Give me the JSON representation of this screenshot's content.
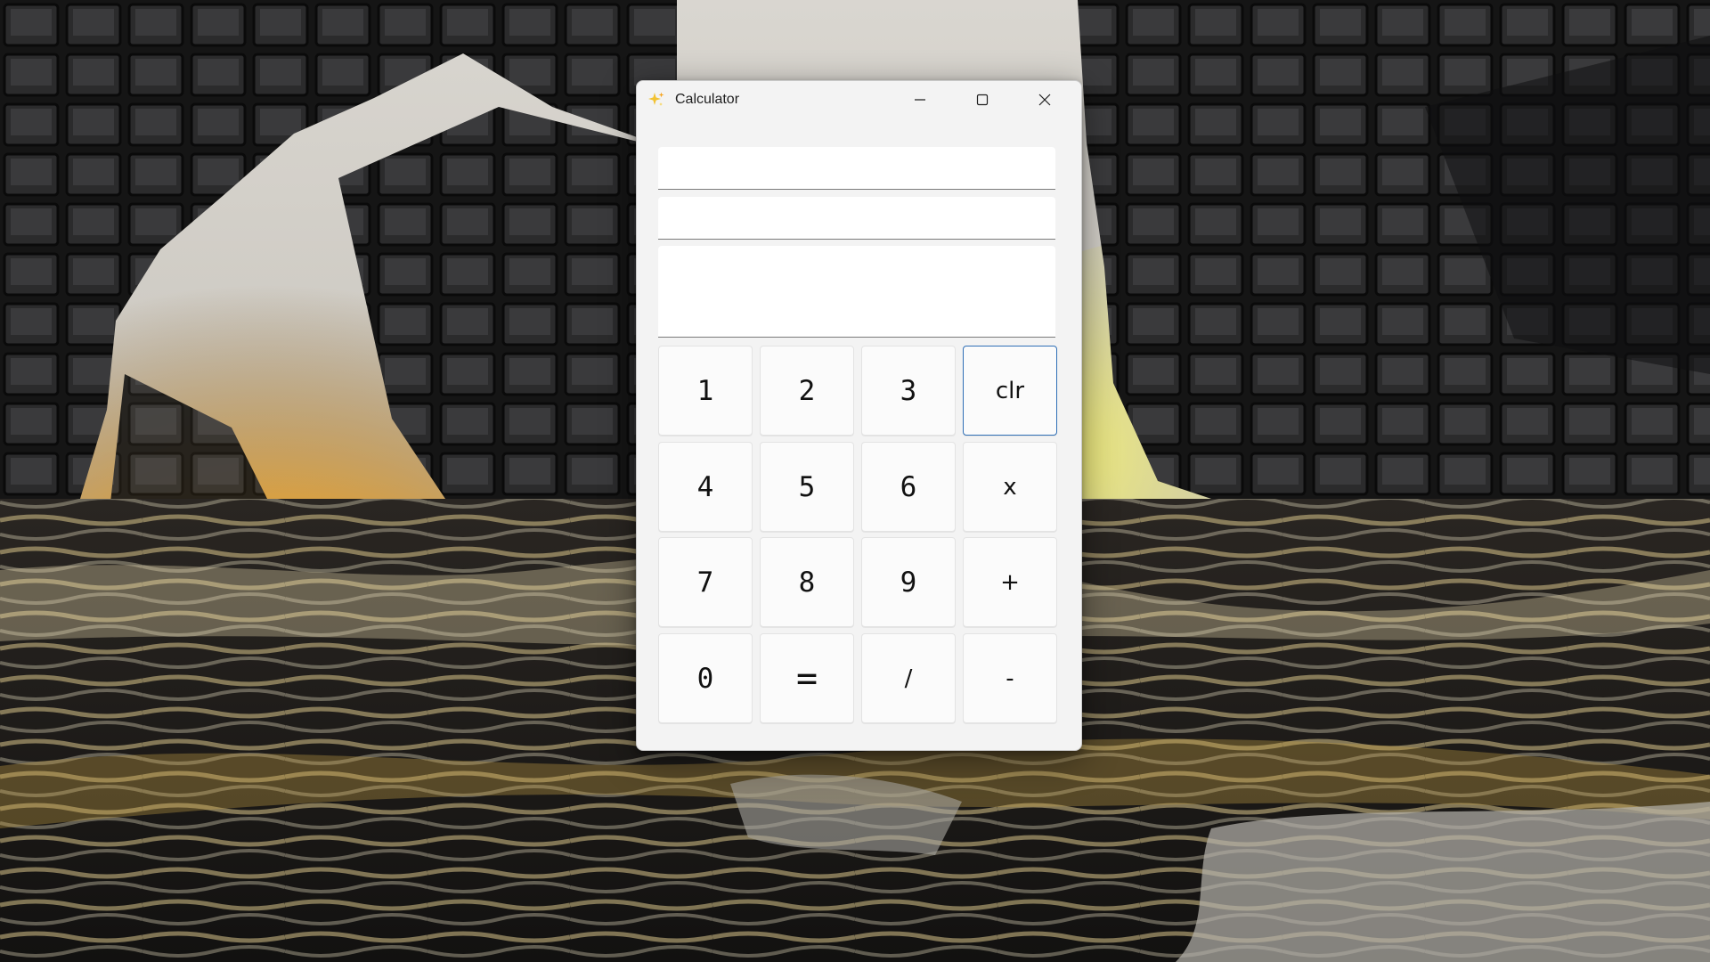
{
  "window": {
    "title": "Calculator",
    "controls": {
      "minimize": "minimize-icon",
      "maximize": "maximize-icon",
      "close": "close-icon"
    }
  },
  "display": {
    "operand_field": "",
    "expression_field": "",
    "result_field": ""
  },
  "keypad": {
    "k1": "1",
    "k2": "2",
    "k3": "3",
    "clear": "clr",
    "k4": "4",
    "k5": "5",
    "k6": "6",
    "multiply": "x",
    "k7": "7",
    "k8": "8",
    "k9": "9",
    "add": "+",
    "k0": "0",
    "equals": "=",
    "divide": "/",
    "subtract": "-"
  },
  "colors": {
    "window_bg": "#f3f3f3",
    "key_bg": "#fbfbfb",
    "focus_border": "#2f6fb6",
    "field_underline": "#7a7a7a",
    "app_icon": "#f2c232"
  }
}
